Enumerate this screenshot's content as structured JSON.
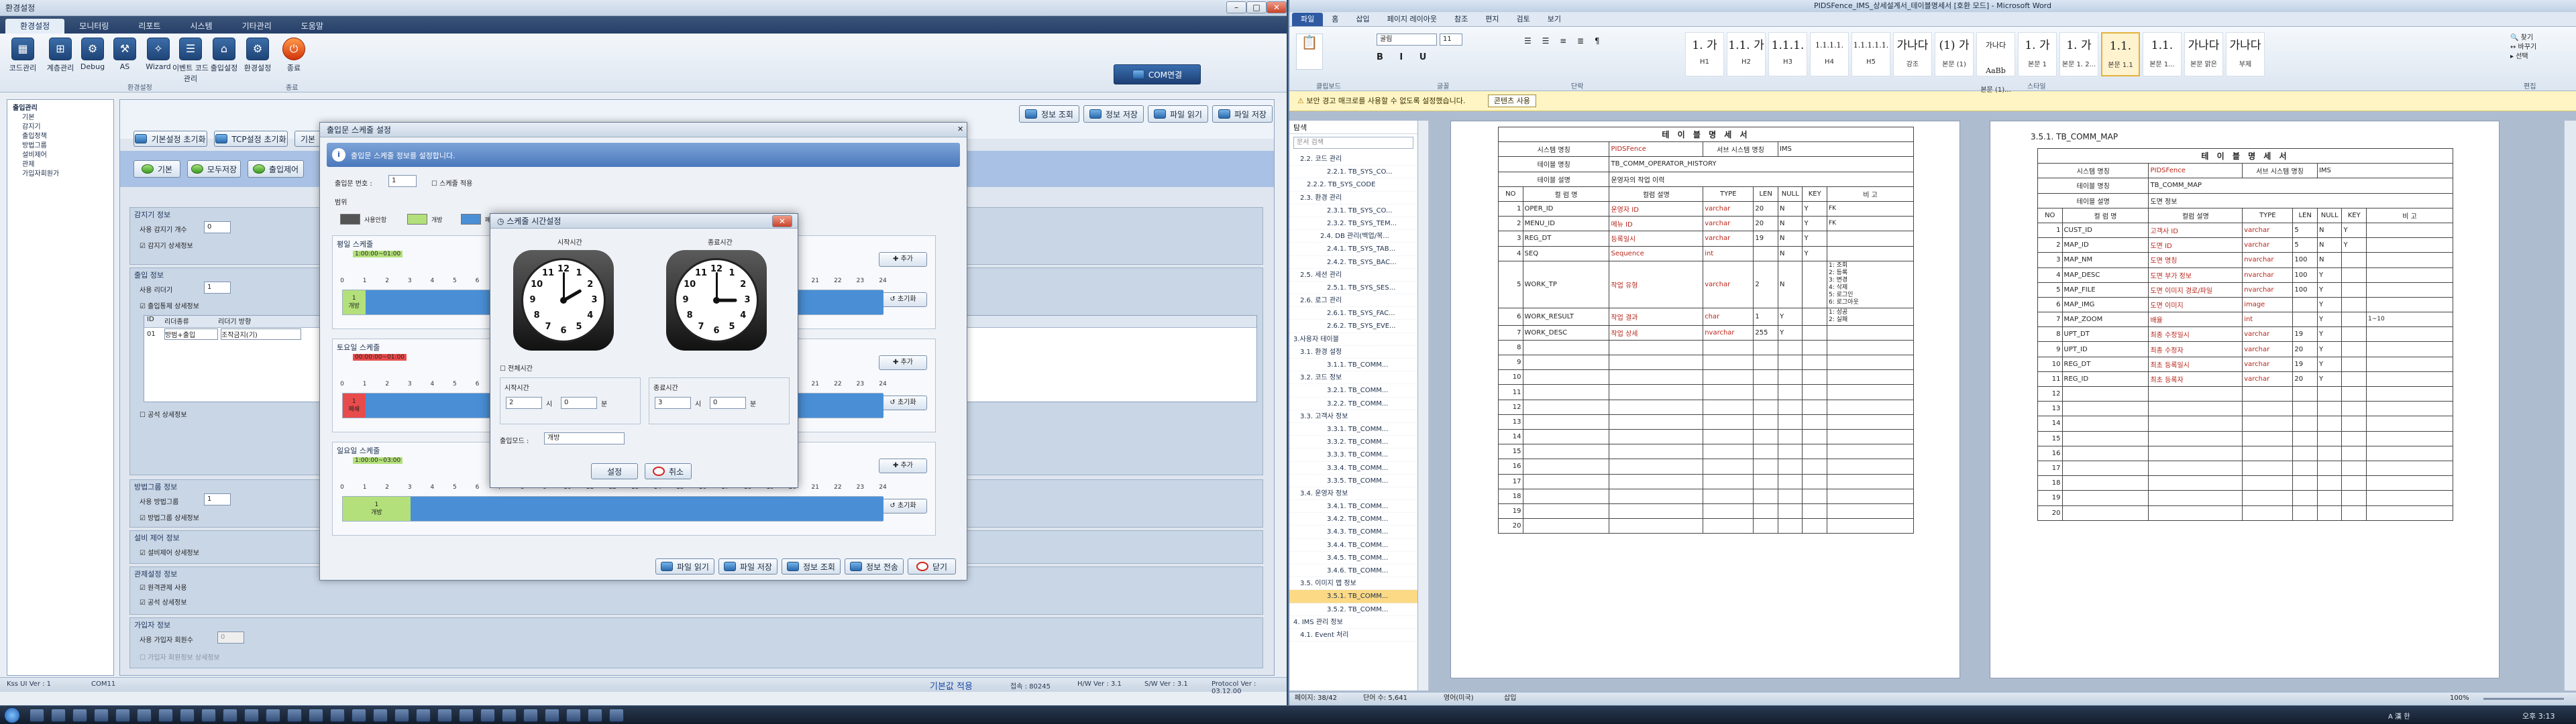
{
  "left_window": {
    "title": "환경설정",
    "menu_tabs": [
      "환경설정",
      "모니터링",
      "리포트",
      "시스템",
      "기타관리",
      "도움말"
    ],
    "ribbon_buttons": [
      {
        "label": "코드관리",
        "icon": "grid-icon"
      },
      {
        "label": "계층관리",
        "icon": "tree-icon"
      },
      {
        "label": "Debug",
        "icon": "bug-icon"
      },
      {
        "label": "AS",
        "icon": "tool-icon"
      },
      {
        "label": "Wizard",
        "icon": "wand-icon"
      },
      {
        "label": "이벤트 코드관리",
        "icon": "list-icon"
      },
      {
        "label": "출입설정",
        "icon": "door-icon"
      },
      {
        "label": "환경설정",
        "icon": "gear-icon"
      },
      {
        "label": "종료",
        "icon": "power-icon"
      }
    ],
    "ribbon_groups": [
      "환경설정",
      "종료"
    ],
    "com_button": "COM연결",
    "sidebar_tree": [
      "출입관리",
      "기본",
      "감지기",
      "출입정책",
      "방법그룹",
      "설비제어",
      "관제",
      "가입자회원가"
    ],
    "top_right_buttons": [
      "정보 조회",
      "정보 저장",
      "파일 읽기",
      "파일 저장"
    ],
    "toolbar_buttons": [
      "기본설정 초기화",
      "TCP설정 초기화",
      "기본"
    ],
    "action_buttons": [
      "기본",
      "모두저장",
      "출입제어"
    ],
    "sections": [
      {
        "title": "감지기 정보",
        "row": "사용 감지기 개수",
        "value": "0",
        "check": "감지기 상세정보"
      },
      {
        "title": "출입 정보",
        "row": "사용 리더기",
        "value": "1",
        "check": "출입통제 상세정보"
      },
      {
        "title": "방법그룹 정보",
        "row": "사용 방법그룹",
        "value": "1",
        "check": "방법그룹 상세정보"
      },
      {
        "title": "설비 제어 정보",
        "row": "",
        "value": "",
        "check": "설비제어 상세정보"
      },
      {
        "title": "관제설정 정보",
        "row": "",
        "value": "",
        "check": "원격관제 사용"
      },
      {
        "title": "가입자 정보",
        "row": "사용 가입자 회원수",
        "value": "0",
        "check": "가입자 회원정보 상세정보"
      }
    ],
    "grid_row": {
      "no": "01",
      "col1": "리더종류",
      "col2": "리더기 방향",
      "val1": "방범+출입",
      "val2": "조작금지(기)"
    },
    "extra_check": "공석 상세정보",
    "status": {
      "left": "Kss UI Ver : 1",
      "com": "COM11",
      "center": "기본값 적용",
      "ip": "접속 : 80245",
      "hw": "H/W Ver : 3.1",
      "sw": "S/W Ver : 3.1",
      "proto": "Protocol Ver : 03.12.00"
    }
  },
  "schedule_dialog": {
    "title": "출입문 스케줄 설정",
    "banner": "출입문 스케줄 정보를 설정합니다.",
    "door_label": "출입문 번호 :",
    "door_value": "1",
    "use_schedule": "스케줄 적용",
    "range_label": "범위",
    "legend": [
      {
        "label": "사용안함",
        "color": "#555555"
      },
      {
        "label": "개방",
        "color": "#b3e07a"
      },
      {
        "label": "폐쇄",
        "color": "#e84b4b"
      }
    ],
    "slots": [
      {
        "label": "평일 스케줄",
        "time": "1:00:00~01:00",
        "fill_label": "1\n개방",
        "fill_color": "#b3e07a",
        "fill_start_h": 0,
        "fill_end_h": 1,
        "rest_color": "#4a8fd6"
      },
      {
        "label": "토요일 스케줄",
        "time": "00:00:00~01:00",
        "fill_label": "1\n폐쇄",
        "fill_color": "#e84b4b",
        "fill_start_h": 0,
        "fill_end_h": 1,
        "rest_color": "#4a8fd6"
      },
      {
        "label": "일요일 스케줄",
        "time": "1:00:00~03:00",
        "fill_label": "1\n개방",
        "fill_color": "#b3e07a",
        "fill_start_h": 0,
        "fill_end_h": 3,
        "rest_color": "#4a8fd6"
      }
    ],
    "hours": [
      "0",
      "1",
      "2",
      "3",
      "4",
      "5",
      "6",
      "7",
      "8",
      "9",
      "10",
      "11",
      "12",
      "13",
      "14",
      "15",
      "16",
      "17",
      "18",
      "19",
      "20",
      "21",
      "22",
      "23",
      "24"
    ],
    "slot_add": "추가",
    "slot_reset": "초기화",
    "footer_buttons": [
      "파일 읽기",
      "파일 저장",
      "정보 조회",
      "정보 전송",
      "닫기"
    ]
  },
  "time_dialog": {
    "title": "스케줄 시간설정",
    "start_label": "시작시간",
    "end_label": "종료시간",
    "fullday": "전체시간",
    "start_section": "시작시간",
    "end_section": "종료시간",
    "start_hour": "2",
    "start_min": "0",
    "end_hour": "3",
    "end_min": "0",
    "hour_unit": "시",
    "min_unit": "분",
    "mode_label": "출입모드 :",
    "mode_value": "개방",
    "ok": "설정",
    "cancel": "취소",
    "clock_numbers": [
      "12",
      "1",
      "2",
      "3",
      "4",
      "5",
      "6",
      "7",
      "8",
      "9",
      "10",
      "11"
    ]
  },
  "right_window": {
    "title": "PIDSFence_IMS_상세설계서_테이블명세서 [호환 모드] - Microsoft Word",
    "tabs": [
      "파일",
      "홈",
      "삽입",
      "페이지 레이아웃",
      "참조",
      "편지",
      "검토",
      "보기"
    ],
    "font_name": "굴림",
    "font_size": "11",
    "styles": [
      {
        "big": "1. 가",
        "cap": "H1"
      },
      {
        "big": "1.1. 가",
        "cap": "H2"
      },
      {
        "big": "1.1.1.",
        "cap": "H3"
      },
      {
        "big": "1.1.1.1.",
        "cap": "H4"
      },
      {
        "big": "1.1.1.1.1.",
        "cap": "H5"
      },
      {
        "big": "가나다",
        "cap": "강조"
      },
      {
        "big": "(1) 가",
        "cap": "본문 (1)"
      },
      {
        "big": "가나다AaBb",
        "cap": "본문 (1)..."
      },
      {
        "big": "1. 가",
        "cap": "본문 1"
      },
      {
        "big": "1. 가",
        "cap": "본문 1. 2..."
      },
      {
        "big": "1.1.",
        "cap": "본문 1.1"
      },
      {
        "big": "1.1.",
        "cap": "본문 1..."
      },
      {
        "big": "가나다",
        "cap": "본문 맑은"
      },
      {
        "big": "가나다",
        "cap": "부제"
      }
    ],
    "groups": [
      "클립보드",
      "글꼴",
      "단락",
      "스타일",
      "편집"
    ],
    "warning": "보안 경고   매크로를 사용할 수 없도록 설정했습니다.",
    "warning_btn": "콘텐츠 사용",
    "nav_title": "탐색",
    "nav_search": "문서 검색",
    "nav_items": [
      "2.2. 코드 관리",
      "2.2.1. TB_SYS_CO...",
      "2.2.2. TB_SYS_CODE",
      "2.3. 환경 관리",
      "2.3.1. TB_SYS_CO...",
      "2.3.2. TB_SYS_TEM...",
      "2.4. DB 관리(백업/복...",
      "2.4.1. TB_SYS_TAB...",
      "2.4.2. TB_SYS_BAC...",
      "2.5. 세션 관리",
      "2.5.1. TB_SYS_SES...",
      "2.6. 로그 관리",
      "2.6.1. TB_SYS_FAC...",
      "2.6.2. TB_SYS_EVE...",
      "3.사용자 테이블",
      "3.1. 환경 설정",
      "3.1.1. TB_COMM...",
      "3.2. 코드 정보",
      "3.2.1. TB_COMM...",
      "3.2.2. TB_COMM...",
      "3.3. 고객사 정보",
      "3.3.1. TB_COMM...",
      "3.3.2. TB_COMM...",
      "3.3.3. TB_COMM...",
      "3.3.4. TB_COMM...",
      "3.3.5. TB_COMM...",
      "3.4. 운영자 정보",
      "3.4.1. TB_COMM...",
      "3.4.2. TB_COMM...",
      "3.4.3. TB_COMM...",
      "3.4.4. TB_COMM...",
      "3.4.5. TB_COMM...",
      "3.4.6. TB_COMM...",
      "3.5. 이미지 맵 정보",
      "3.5.1. TB_COMM...",
      "3.5.2. TB_COMM...",
      "4. IMS 관리 정보",
      "4.1. Event 처리"
    ],
    "page1": {
      "title": "테 이 블 명 세 서",
      "system_label": "시스템 명칭",
      "system": "PIDSFence",
      "server_label": "서브 시스템 명칭",
      "server": "IMS",
      "table_label": "테이블 명칭",
      "table": "TB_COMM_OPERATOR_HISTORY",
      "desc_label": "테이블 설명",
      "desc": "운영자의 작업 이력",
      "headers": [
        "NO",
        "컬 럼 명",
        "컬럼 설명",
        "TYPE",
        "LEN",
        "NULL",
        "KEY",
        "비  고"
      ],
      "rows": [
        [
          "1",
          "OPER_ID",
          "운영자 ID",
          "varchar",
          "20",
          "N",
          "Y",
          "FK"
        ],
        [
          "2",
          "MENU_ID",
          "메뉴 ID",
          "varchar",
          "20",
          "N",
          "Y",
          "FK"
        ],
        [
          "3",
          "REG_DT",
          "등록일시",
          "varchar",
          "19",
          "N",
          "Y",
          ""
        ],
        [
          "4",
          "SEQ",
          "Sequence",
          "int",
          "",
          "N",
          "Y",
          ""
        ],
        [
          "5",
          "WORK_TP",
          "작업 유형",
          "varchar",
          "2",
          "N",
          "",
          "1: 조회\n2: 등록\n3: 변경\n4: 삭제\n5: 로그인\n6: 로그아웃"
        ],
        [
          "6",
          "WORK_RESULT",
          "작업 결과",
          "char",
          "1",
          "Y",
          "",
          "1: 성공\n2: 실패"
        ],
        [
          "7",
          "WORK_DESC",
          "작업 상세",
          "nvarchar",
          "255",
          "Y",
          "",
          ""
        ]
      ],
      "blank_rows": [
        "8",
        "9",
        "10",
        "11",
        "12",
        "13",
        "14",
        "15",
        "16",
        "17",
        "18",
        "19",
        "20"
      ]
    },
    "page2": {
      "heading": "3.5.1. TB_COMM_MAP",
      "title": "테 이 블 명 세 서",
      "system_label": "시스템 명칭",
      "system": "PIDSFence",
      "server_label": "서브 시스템 명칭",
      "server": "IMS",
      "table_label": "테이블 명칭",
      "table": "TB_COMM_MAP",
      "desc_label": "테이블 설명",
      "desc": "도면 정보",
      "headers": [
        "NO",
        "컬 럼 명",
        "컬럼 설명",
        "TYPE",
        "LEN",
        "NULL",
        "KEY",
        "비  고"
      ],
      "rows": [
        [
          "1",
          "CUST_ID",
          "고객사 ID",
          "varchar",
          "5",
          "N",
          "Y",
          ""
        ],
        [
          "2",
          "MAP_ID",
          "도면 ID",
          "varchar",
          "5",
          "N",
          "Y",
          ""
        ],
        [
          "3",
          "MAP_NM",
          "도면 명칭",
          "nvarchar",
          "100",
          "N",
          "",
          ""
        ],
        [
          "4",
          "MAP_DESC",
          "도면 부가 정보",
          "nvarchar",
          "100",
          "Y",
          "",
          ""
        ],
        [
          "5",
          "MAP_FILE",
          "도면 이미지 경로/파일",
          "nvarchar",
          "100",
          "Y",
          "",
          ""
        ],
        [
          "6",
          "MAP_IMG",
          "도면 이미지",
          "image",
          "",
          "Y",
          "",
          ""
        ],
        [
          "7",
          "MAP_ZOOM",
          "배율",
          "int",
          "",
          "Y",
          "",
          "1~10"
        ],
        [
          "8",
          "UPT_DT",
          "최종 수정일시",
          "varchar",
          "19",
          "Y",
          "",
          ""
        ],
        [
          "9",
          "UPT_ID",
          "최종 수정자",
          "varchar",
          "20",
          "Y",
          "",
          ""
        ],
        [
          "10",
          "REG_DT",
          "최초 등록일시",
          "varchar",
          "19",
          "Y",
          "",
          ""
        ],
        [
          "11",
          "REG_ID",
          "최초 등록자",
          "varchar",
          "20",
          "Y",
          "",
          ""
        ]
      ],
      "blank_rows": [
        "12",
        "13",
        "14",
        "15",
        "16",
        "17",
        "18",
        "19",
        "20"
      ]
    },
    "status": {
      "page": "페이지: 38/42",
      "words": "단어 수: 5,641",
      "lang": "영어(미국)",
      "mode": "삽입",
      "zoom": "100%"
    }
  },
  "taskbar": {
    "clock": "오후 3:13",
    "lang": "A 漢 한"
  }
}
